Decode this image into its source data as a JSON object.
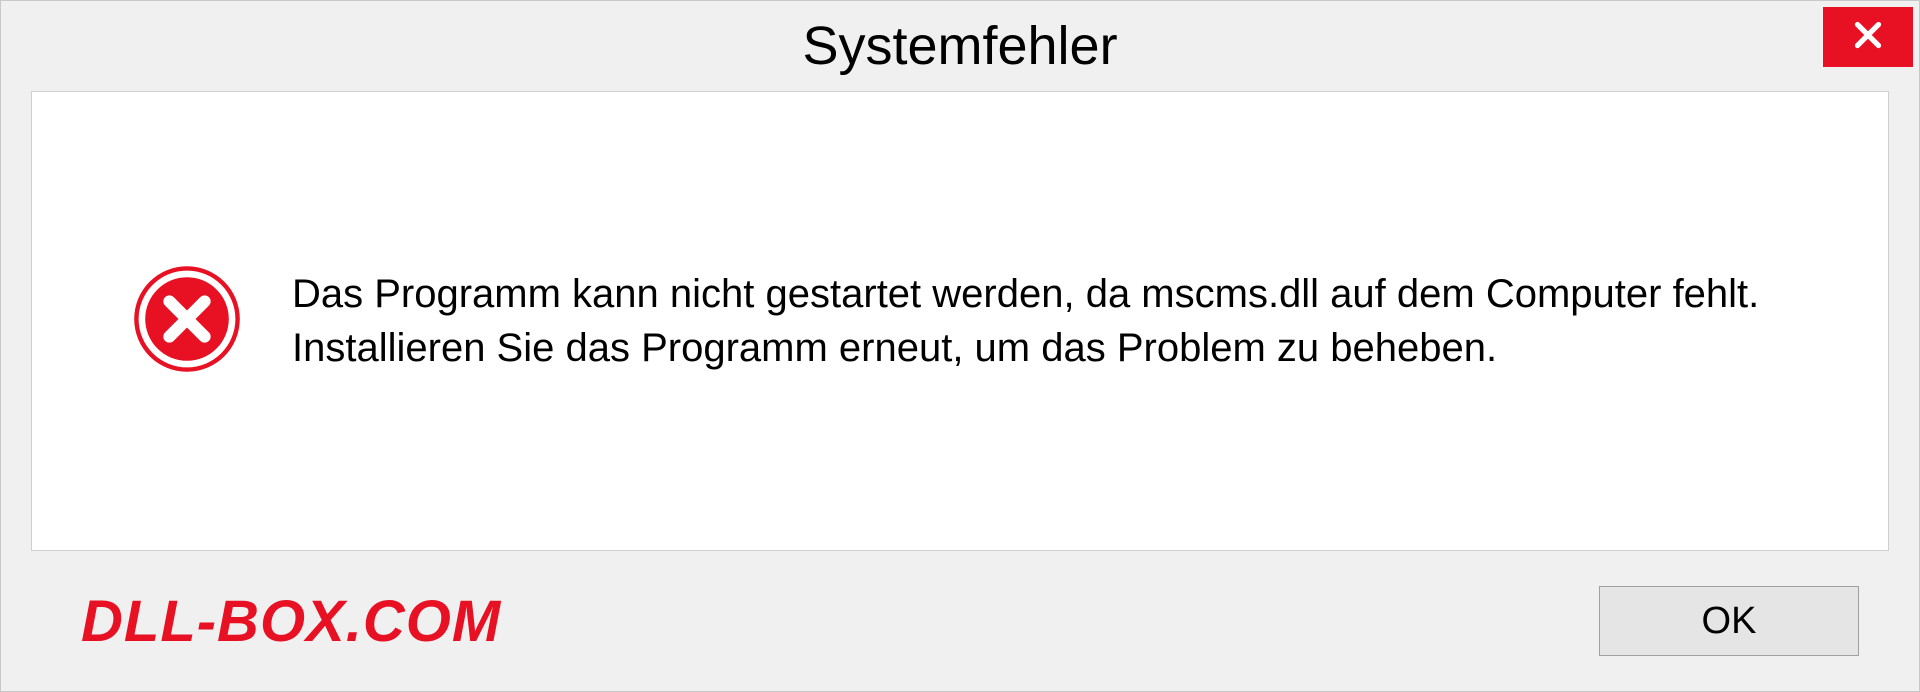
{
  "dialog": {
    "title": "Systemfehler",
    "message": "Das Programm kann nicht gestartet werden, da mscms.dll auf dem Computer fehlt. Installieren Sie das Programm erneut, um das Problem zu beheben.",
    "ok_label": "OK"
  },
  "watermark": {
    "text": "DLL-BOX.COM"
  },
  "icons": {
    "close": "close-icon",
    "error": "error-circle-icon"
  },
  "colors": {
    "accent_red": "#e81123",
    "background": "#f0f0f0",
    "panel": "#ffffff",
    "border": "#c8c8c8"
  }
}
